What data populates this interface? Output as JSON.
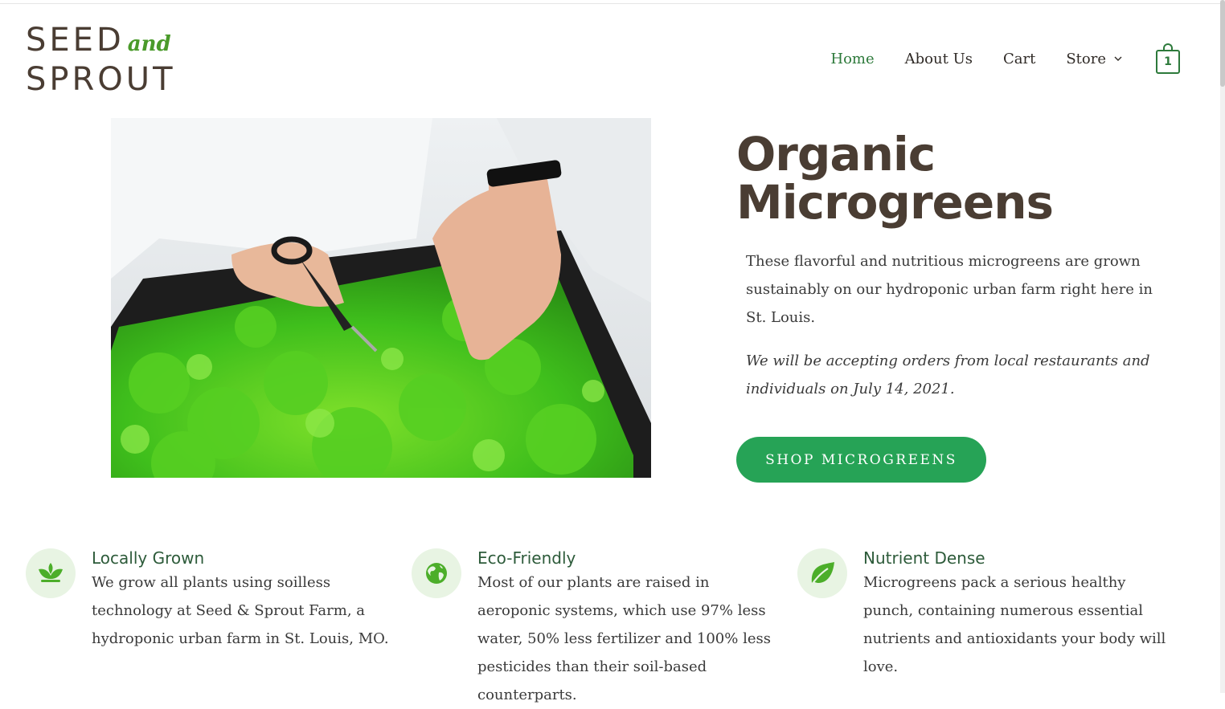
{
  "brand": {
    "line1": "SEED",
    "and": "and",
    "line2": "SPROUT"
  },
  "nav": {
    "items": [
      {
        "label": "Home",
        "active": true
      },
      {
        "label": "About Us",
        "active": false
      },
      {
        "label": "Cart",
        "active": false
      },
      {
        "label": "Store",
        "active": false,
        "has_dropdown": true
      }
    ],
    "cart_count": "1"
  },
  "hero": {
    "image_alt": "Hands harvesting microgreens with scissors",
    "title_line1": "Organic",
    "title_line2": "Microgreens",
    "description": "These flavorful and nutritious microgreens are grown sustainably on our hydroponic urban farm right here in St. Louis.",
    "note": "We will be accepting orders from local restaurants and individuals on July 14, 2021.",
    "cta": "SHOP MICROGREENS"
  },
  "features": [
    {
      "icon": "sprout-icon",
      "title": "Locally Grown",
      "text": "We grow all plants using soilless technology at Seed & Sprout Farm, a hydroponic urban farm in St. Louis, MO."
    },
    {
      "icon": "globe-icon",
      "title": "Eco-Friendly",
      "text": "Most of our plants are raised in aeroponic systems, which use 97% less water, 50% less fertilizer and 100% less pesticides than their soil-based counterparts."
    },
    {
      "icon": "leaf-icon",
      "title": "Nutrient Dense",
      "text": "Microgreens pack a serious healthy punch, containing numerous essential nutrients and antioxidants your body will love."
    }
  ],
  "colors": {
    "brand_dark": "#4a3d33",
    "accent_green": "#26a356",
    "nav_active": "#2d7a3b",
    "icon_bg": "#e8f4e3",
    "icon_green": "#5bb531"
  }
}
